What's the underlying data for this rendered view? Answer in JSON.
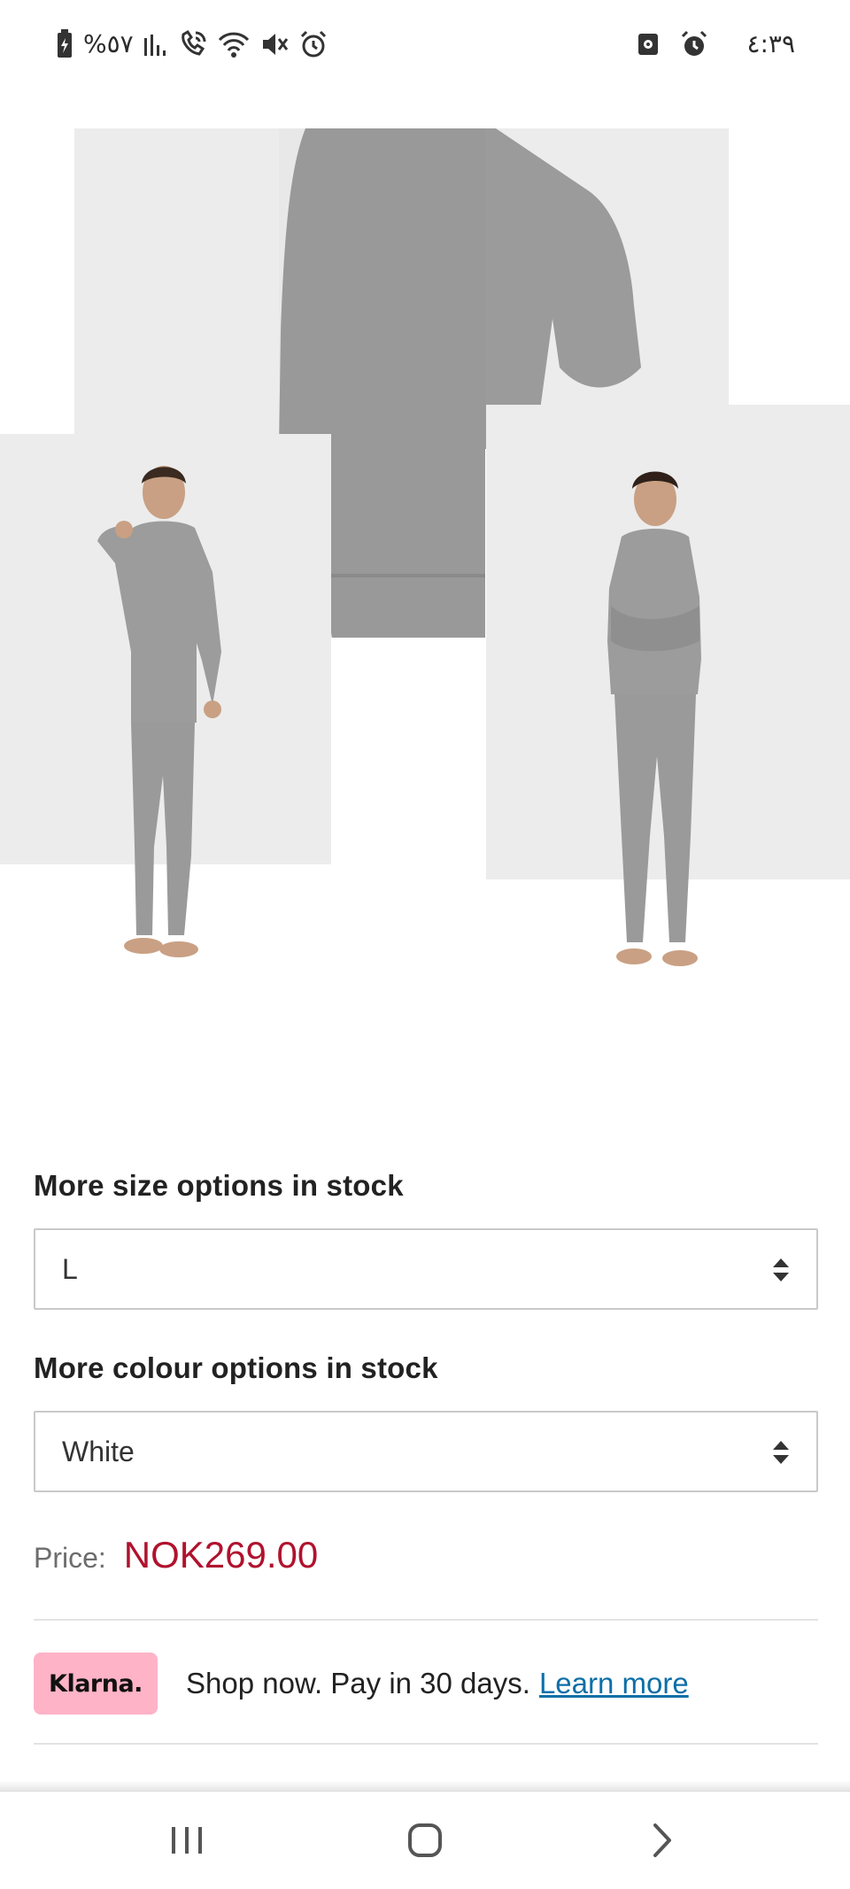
{
  "status_bar": {
    "battery_text": "%٥٧",
    "time": "٤:٣٩",
    "left_icons": [
      "battery-icon",
      "signal-icon",
      "call-icon",
      "wifi-icon",
      "mute-icon",
      "alarm-icon"
    ],
    "right_icons": [
      "screen-recorder-icon",
      "alarm-icon"
    ]
  },
  "gallery": {
    "image_count": 5,
    "active_index": 0,
    "colors": {
      "active_dot": "#0f6fb5",
      "inactive_dot": "#e6e9ee",
      "garment": "#9b9b9b"
    }
  },
  "size_option": {
    "label": "More size options in stock",
    "value": "L",
    "icon": "sort-arrows-icon"
  },
  "colour_option": {
    "label": "More colour options in stock",
    "value": "White",
    "icon": "sort-arrows-icon"
  },
  "price": {
    "label": "Price:",
    "value": "NOK269.00",
    "color": "#b0122e"
  },
  "klarna": {
    "badge": "Klarna.",
    "text": "Shop now. Pay in 30 days.",
    "link": "Learn more",
    "badge_color": "#ffb3c7",
    "link_color": "#0e6fa8"
  },
  "nav_bar": {
    "buttons": [
      "recent-apps-icon",
      "home-icon",
      "back-icon"
    ]
  }
}
